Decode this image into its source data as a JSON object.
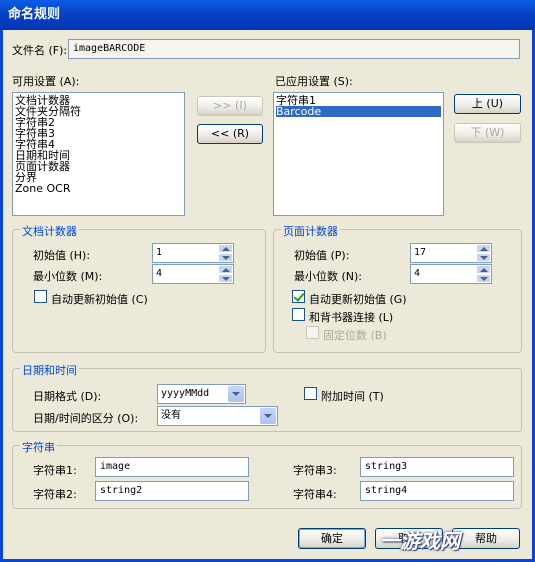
{
  "window": {
    "title": "命名规则"
  },
  "filename": {
    "label": "文件名 (F):",
    "value": "imageBARCODE"
  },
  "available": {
    "label": "可用设置 (A):",
    "items": [
      "文档计数器",
      "文件夹分隔符",
      "字符串2",
      "字符串3",
      "字符串4",
      "日期和时间",
      "页面计数器",
      "分界",
      "Zone OCR"
    ]
  },
  "applied": {
    "label": "已应用设置 (S):",
    "items": [
      "字符串1",
      "Barcode"
    ],
    "selected": "Barcode"
  },
  "buttons": {
    "add": ">> (I)",
    "remove": "<< (R)",
    "up": "上 (U)",
    "down": "下 (W)",
    "ok": "确定",
    "cancel": "取消",
    "help": "帮助"
  },
  "doc_counter": {
    "title": "文档计数器",
    "initial_label": "初始值 (H):",
    "initial_value": "1",
    "min_label": "最小位数 (M):",
    "min_value": "4",
    "auto_label": "自动更新初始值 (C)",
    "auto_checked": false
  },
  "page_counter": {
    "title": "页面计数器",
    "initial_label": "初始值 (P):",
    "initial_value": "17",
    "min_label": "最小位数 (N):",
    "min_value": "4",
    "auto_label": "自动更新初始值 (G)",
    "auto_checked": true,
    "endorser_label": "和背书器连接 (L)",
    "endorser_checked": false,
    "fixed_label": "固定位数 (B)",
    "fixed_checked": false
  },
  "datetime": {
    "title": "日期和时间",
    "format_label": "日期格式 (D):",
    "format_value": "yyyyMMdd",
    "sep_label": "日期/时间的区分 (O):",
    "sep_value": "没有",
    "addtime_label": "附加时间 (T)",
    "addtime_checked": false
  },
  "strings": {
    "title": "字符串",
    "s1_label": "字符串1:",
    "s1_value": "image",
    "s2_label": "字符串2:",
    "s2_value": "string2",
    "s3_label": "字符串3:",
    "s3_value": "string3",
    "s4_label": "字符串4:",
    "s4_value": "string4"
  },
  "watermark": "一游戏网",
  "colors": {
    "titlebar": "#0a5de8",
    "group_title": "#0046d5",
    "selection": "#316ac5",
    "face": "#ece9d8"
  }
}
